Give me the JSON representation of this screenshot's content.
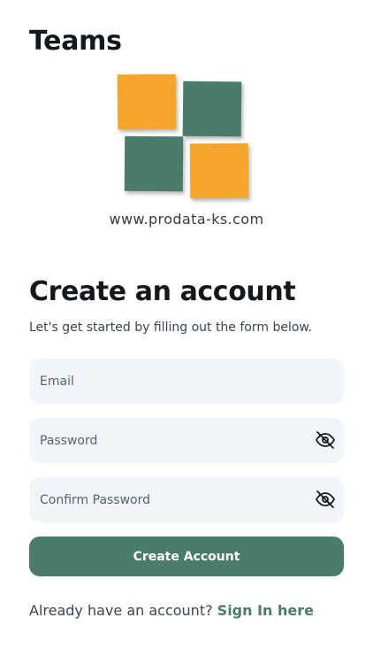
{
  "header": {
    "app_title": "Teams"
  },
  "logo": {
    "url_text": "www.prodata-ks.com",
    "colors": {
      "orange": "#f5a52a",
      "green": "#4a7c6b"
    }
  },
  "form": {
    "title": "Create an account",
    "subtitle": "Let's get started by filling out the form below.",
    "email": {
      "placeholder": "Email",
      "value": ""
    },
    "password": {
      "placeholder": "Password",
      "value": "",
      "toggle_icon": "eye-off-icon"
    },
    "confirm_password": {
      "placeholder": "Confirm Password",
      "value": "",
      "toggle_icon": "eye-off-icon"
    },
    "submit_label": "Create Account"
  },
  "footer": {
    "prompt": "Already have an account? ",
    "link_label": "Sign In here"
  },
  "theme": {
    "accent": "#4a7c6b",
    "field_background": "#f1f4f8"
  }
}
